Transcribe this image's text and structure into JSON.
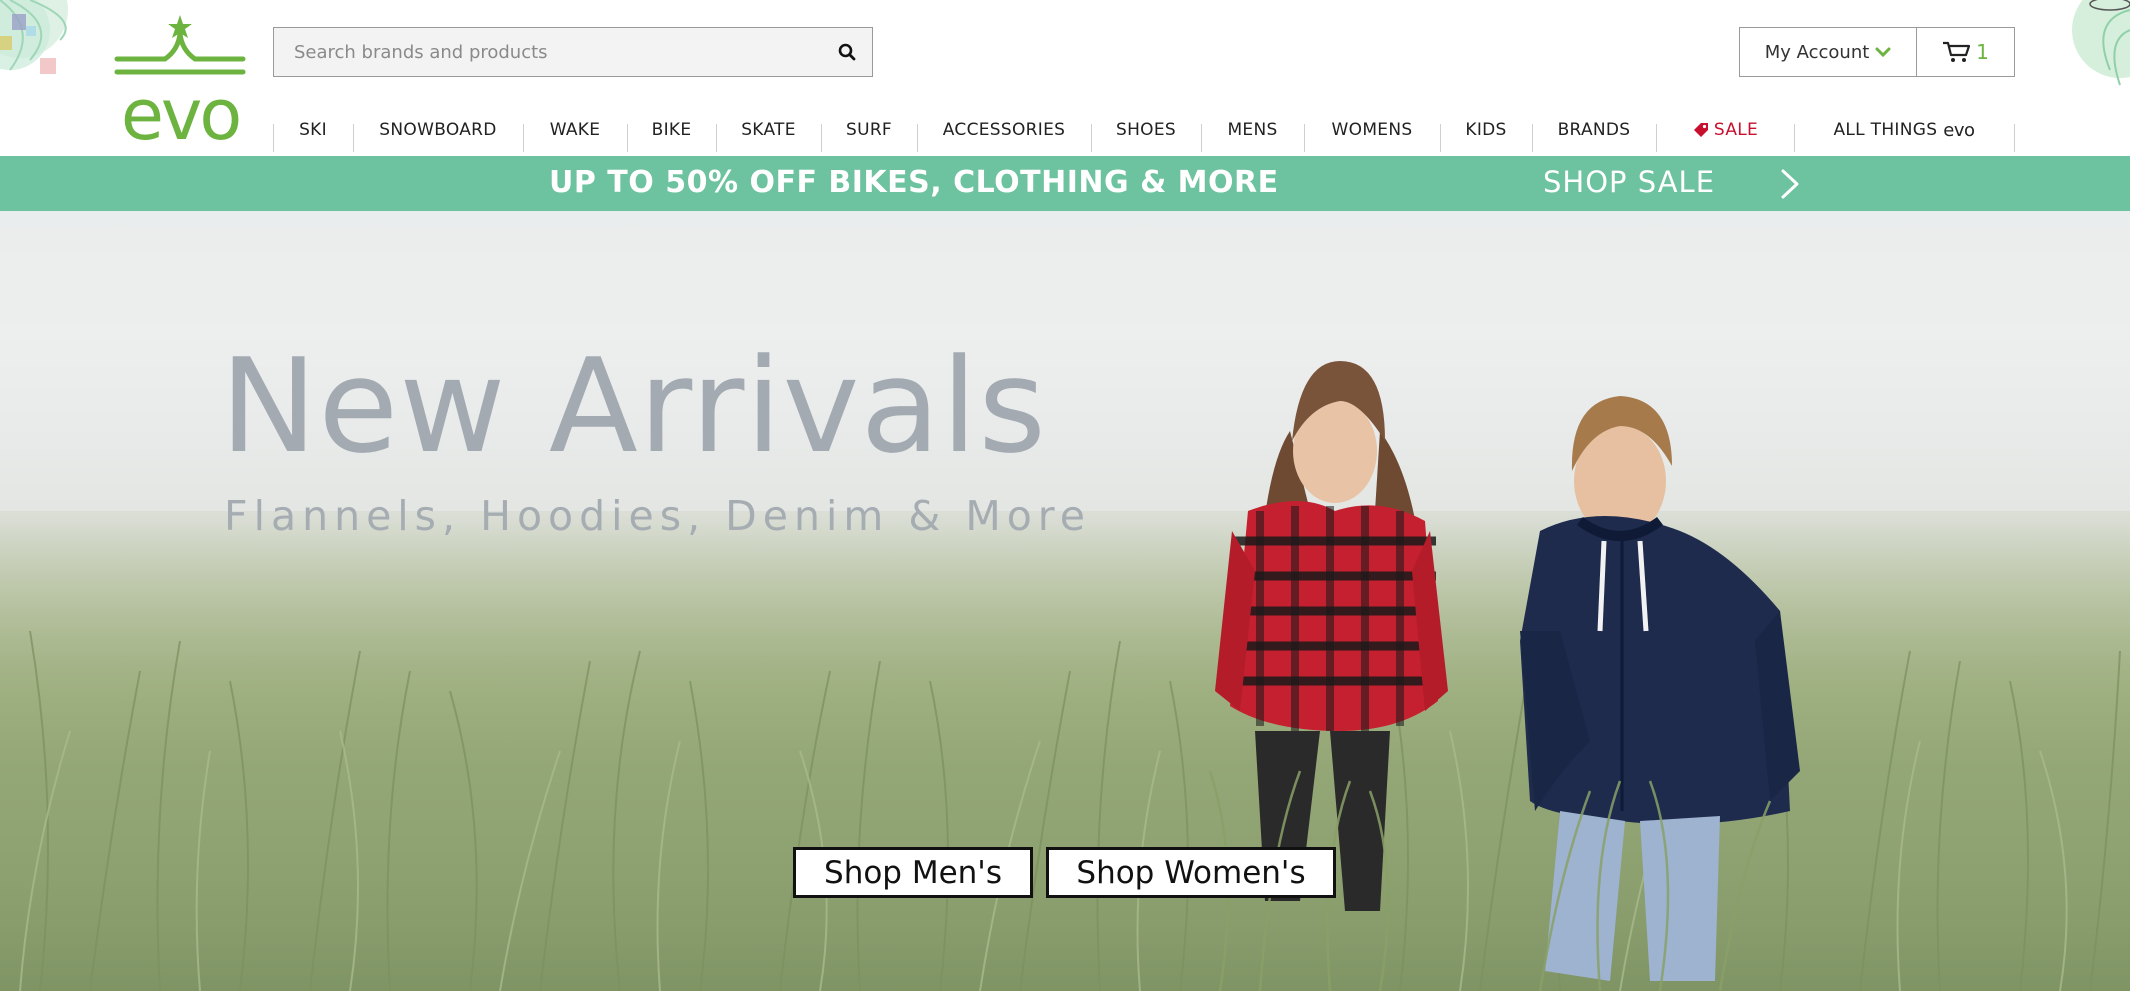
{
  "brand": {
    "logo_text": "evo",
    "accent_color": "#6db33f"
  },
  "search": {
    "placeholder": "Search brands and products",
    "icon": "search-icon"
  },
  "account": {
    "label": "My Account",
    "icon": "chevron-down-icon"
  },
  "cart": {
    "count": "1",
    "icon": "cart-icon"
  },
  "nav": {
    "items": [
      {
        "label": "SKI"
      },
      {
        "label": "SNOWBOARD"
      },
      {
        "label": "WAKE"
      },
      {
        "label": "BIKE"
      },
      {
        "label": "SKATE"
      },
      {
        "label": "SURF"
      },
      {
        "label": "ACCESSORIES"
      },
      {
        "label": "SHOES"
      },
      {
        "label": "MENS"
      },
      {
        "label": "WOMENS"
      },
      {
        "label": "KIDS"
      },
      {
        "label": "BRANDS"
      },
      {
        "label": "SALE",
        "icon": "tag-icon",
        "color": "#c8102e"
      },
      {
        "label": "ALL THINGS",
        "suffix": "evo"
      }
    ]
  },
  "promo": {
    "text": "UP TO 50% OFF BIKES, CLOTHING & MORE",
    "cta": "SHOP SALE",
    "background": "#6dc2a0",
    "icon": "chevron-right-icon"
  },
  "hero": {
    "title": "New Arrivals",
    "subtitle": "Flannels, Hoodies, Denim & More",
    "buttons": {
      "mens": "Shop Men's",
      "womens": "Shop Women's"
    }
  }
}
